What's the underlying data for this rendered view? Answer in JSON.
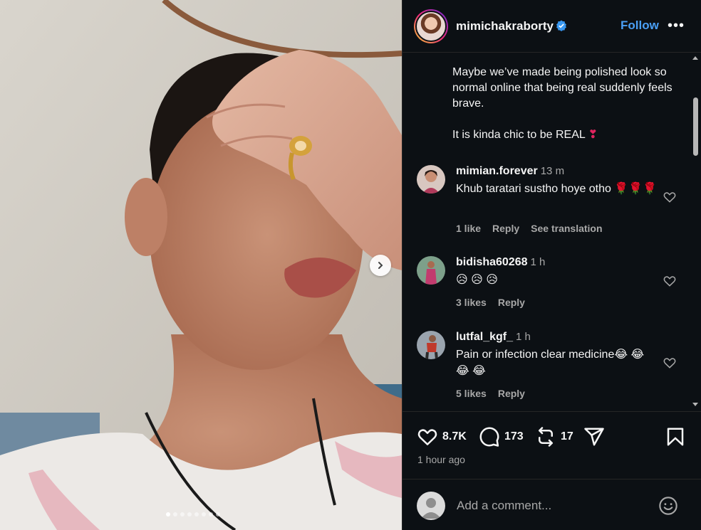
{
  "post": {
    "username": "mimichakraborty",
    "follow_label": "Follow",
    "more_label": "•••",
    "caption_lines": [
      "Maybe we’ve made being polished look so normal online that being real suddenly feels brave.",
      "It is kinda chic to be REAL"
    ],
    "caption_emoji": "❣"
  },
  "comments": [
    {
      "username": "mimian.forever",
      "time": "13 m",
      "text": "Khub taratari sustho hoye otho 🌹🌹🌹",
      "likes": "1 like",
      "reply": "Reply",
      "translate": "See translation"
    },
    {
      "username": "bidisha60268",
      "time": "1 h",
      "text": "😥 😥 😥",
      "likes": "3 likes",
      "reply": "Reply"
    },
    {
      "username": "lutfal_kgf_",
      "time": "1 h",
      "text": "Pain or infection clear medicine😂 😂 😂 😂",
      "likes": "5 likes",
      "reply": "Reply"
    }
  ],
  "actions": {
    "likes": "8.7K",
    "comments": "173",
    "reposts": "17"
  },
  "time_ago": "1 hour ago",
  "add_comment": {
    "placeholder": "Add a comment..."
  },
  "carousel": {
    "total_slides": 8,
    "active_index": 0
  },
  "colors": {
    "panel_bg": "#0c1014",
    "accent": "#4a9ff5",
    "muted": "#a8a8a8",
    "verified": "#3897f0"
  }
}
